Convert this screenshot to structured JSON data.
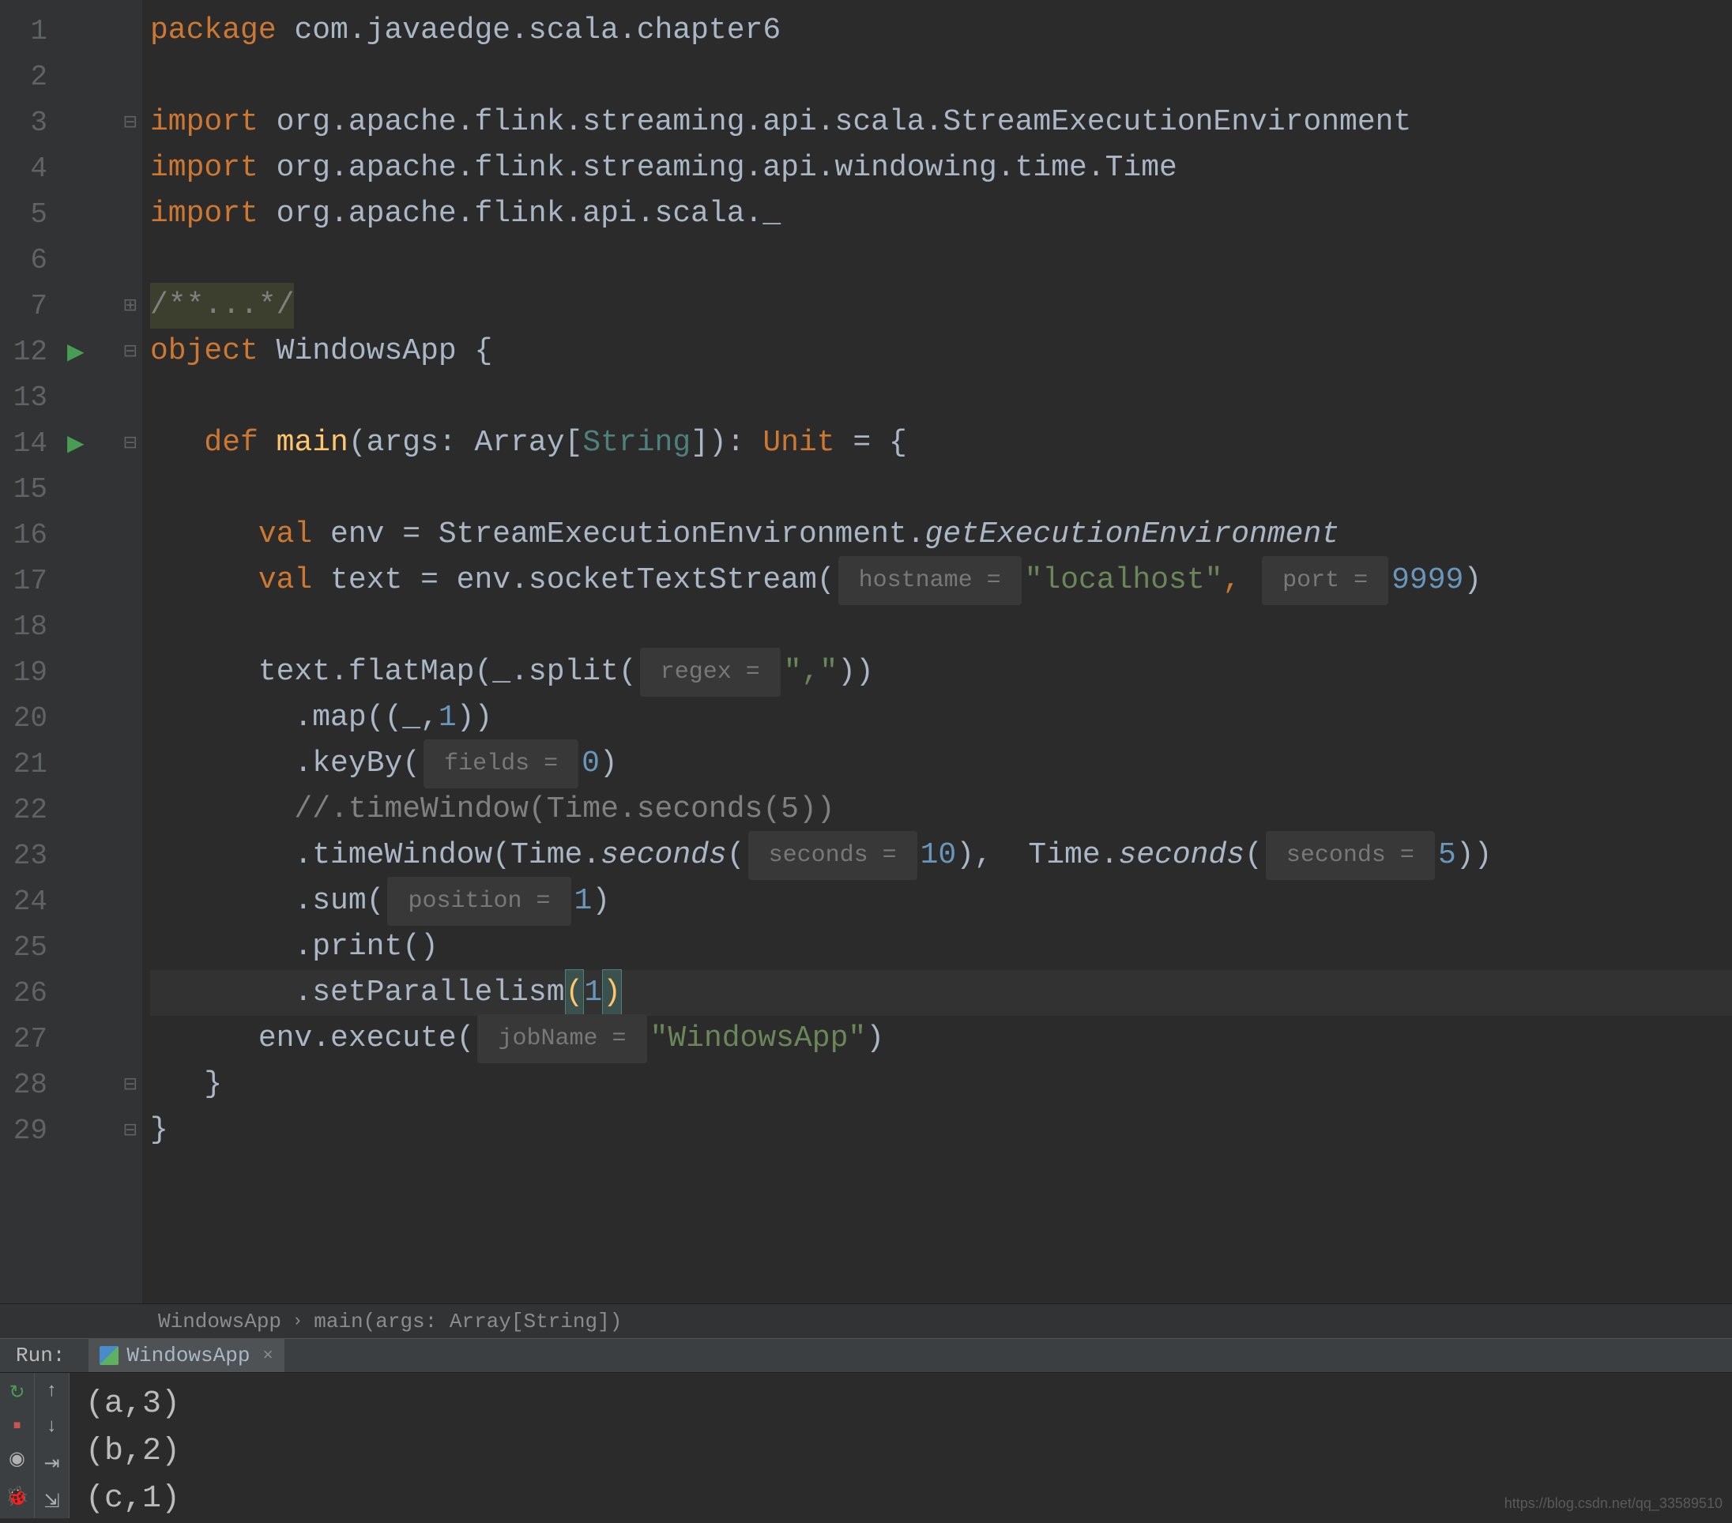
{
  "lines": {
    "1": {
      "num": "1"
    },
    "2": {
      "num": "2"
    },
    "3": {
      "num": "3"
    },
    "4": {
      "num": "4"
    },
    "5": {
      "num": "5"
    },
    "6": {
      "num": "6"
    },
    "7": {
      "num": "7"
    },
    "12": {
      "num": "12"
    },
    "13": {
      "num": "13"
    },
    "14": {
      "num": "14"
    },
    "15": {
      "num": "15"
    },
    "16": {
      "num": "16"
    },
    "17": {
      "num": "17"
    },
    "18": {
      "num": "18"
    },
    "19": {
      "num": "19"
    },
    "20": {
      "num": "20"
    },
    "21": {
      "num": "21"
    },
    "22": {
      "num": "22"
    },
    "23": {
      "num": "23"
    },
    "24": {
      "num": "24"
    },
    "25": {
      "num": "25"
    },
    "26": {
      "num": "26"
    },
    "27": {
      "num": "27"
    },
    "28": {
      "num": "28"
    },
    "29": {
      "num": "29"
    }
  },
  "code": {
    "package_kw": "package ",
    "package_name": "com.javaedge.scala.chapter6",
    "import_kw": "import ",
    "import1": "org.apache.flink.streaming.api.scala.StreamExecutionEnvironment",
    "import2": "org.apache.flink.streaming.api.windowing.time.Time",
    "import3": "org.apache.flink.api.scala._",
    "comment_fold": "/**...*/",
    "object_kw": "object ",
    "object_name": "WindowsApp ",
    "brace_open": "{",
    "def_kw": "def ",
    "main_name": "main",
    "main_args": "(args: Array[",
    "string_type": "String",
    "main_args_end": "]): ",
    "unit_type": "Unit",
    "equals": " = {",
    "val_kw": "val ",
    "env_decl": "env = StreamExecutionEnvironment.",
    "getenv": "getExecutionEnvironment",
    "text_decl": "text = env.socketTextStream(",
    "hint_hostname": " hostname = ",
    "localhost": "\"localhost\"",
    "comma": ", ",
    "hint_port": " port = ",
    "port_num": "9999",
    "close_paren": ")",
    "flatmap_line": "text.flatMap(_.split(",
    "hint_regex": " regex = ",
    "regex_str": "\",\"",
    "flatmap_end": "))",
    "map_line": "  .map((_,",
    "one": "1",
    "map_end": "))",
    "keyby": "  .keyBy(",
    "hint_fields": " fields = ",
    "zero": "0",
    "keyby_end": ")",
    "comment_tw": "  //.timeWindow(Time.seconds(5))",
    "timewindow": "  .timeWindow(Time.",
    "seconds_m": "seconds",
    "tw_open": "(",
    "hint_seconds": " seconds = ",
    "ten": "10",
    "tw_mid": "),  Time.",
    "five": "5",
    "tw_end": "))",
    "sum": "  .sum(",
    "hint_position": " position = ",
    "sum_end": ")",
    "print_line": "  .print()",
    "setpar": "  .setParallelism",
    "setpar_open": "(",
    "setpar_close": ")",
    "execute": "env.execute(",
    "hint_jobname": " jobName = ",
    "jobname": "\"WindowsApp\"",
    "execute_end": ")",
    "brace_close": "}",
    "indent1": "   ",
    "indent2": "      ",
    "indent3": "         "
  },
  "breadcrumb": {
    "item1": "WindowsApp",
    "sep": "›",
    "item2": "main(args: Array[String])"
  },
  "run": {
    "label": "Run:",
    "tab_name": "WindowsApp",
    "close": "×"
  },
  "console": {
    "line1": "(a,3)",
    "line2": "(b,2)",
    "line3": "(c,1)"
  },
  "watermark": "https://blog.csdn.net/qq_33589510"
}
